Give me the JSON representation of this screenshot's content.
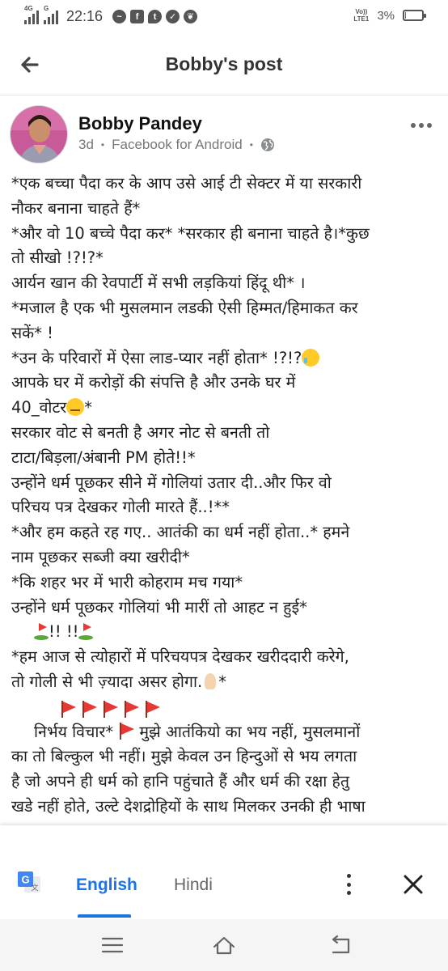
{
  "status_bar": {
    "network_1": "4G",
    "network_2": "G",
    "time": "22:16",
    "app_icons": [
      "messenger-icon",
      "facebook-icon",
      "twitter-icon",
      "checkmark-icon",
      "leaf-icon"
    ],
    "volte_top": "Vo))",
    "volte_bottom": "LTE1",
    "battery_percent": "3%",
    "battery_level": 0.03,
    "battery_color": "#e53935"
  },
  "header": {
    "title": "Bobby's post"
  },
  "post": {
    "author": "Bobby Pandey",
    "time": "3d",
    "source": "Facebook for Android",
    "privacy_icon": "globe-icon",
    "lines": [
      "*एक बच्चा पैदा कर के आप उसे आई टी सेक्टर में या सरकारी",
      "नौकर बनाना चाहते हैं*",
      "*और वो 10 बच्चे पैदा कर* *सरकार ही बनाना चाहते है।*कुछ",
      " तो सीखो  !?!?*",
      "आर्यन खान की रेवपार्टी में सभी लड़कियां हिंदू थी* ।",
      "*मजाल है एक भी मुसलमान लडकी ऐसी हिम्मत/हिमाकत कर",
      "सकें* !",
      "*उन के परिवारों में  ऐसा लाड-प्यार नहीं होता* !?!?",
      "आपके घर में करोड़ों की संपत्ति है और उनके घर में",
      "40_वोटर",
      "सरकार वोट से बनती है अगर नोट से बनती तो",
      "टाटा/बिड़ला/अंबानी PM होते!!*",
      "उन्होंने धर्म पूछकर सीने में गोलियां उतार दी..और फिर वो",
      "परिचय पत्र देखकर गोली मारते हैं..!**",
      "*और हम कहते रह गए.. आतंकी का धर्म नहीं होता..* हमने",
      "नाम पूछकर सब्जी क्या खरीदी*",
      "*कि शहर भर में भारी कोहराम मच गया*",
      "उन्होंने धर्म पूछकर गोलियां भी मारीं तो आहट न हुई*",
      "!! !!",
      "*हम आज से  त्योहारों में परिचयपत्र देखकर खरीददारी करेगे,",
      "तो गोली से भी ज़्यादा असर होगा.",
      "",
      "निर्भय विचार*",
      "मुझे आतंकियो का भय नहीं, मुसलमानों",
      "का तो बिल्कुल भी नहीं। मुझे केवल उन हिन्दुओं से भय लगता",
      "है जो अपने ही धर्म को हानि पहुंचाते हैं और धर्म की रक्षा हेतु",
      "खडे नहीं होते, उल्टे देशद्रोहियों के साथ मिलकर उनकी ही भाषा"
    ],
    "emoji": {
      "crying": "crying-face-emoji",
      "eye_roll": "eye-roll-emoji",
      "pray": "folded-hands-emoji",
      "flag": "triangular-flag-emoji",
      "golf": "golf-flag-emoji"
    }
  },
  "translate_bar": {
    "icon": "google-translate-icon",
    "active_language": "English",
    "other_language": "Hindi",
    "accent_color": "#1a73e8"
  },
  "nav_bar": {
    "buttons": [
      "menu-icon",
      "home-icon",
      "back-icon"
    ]
  }
}
